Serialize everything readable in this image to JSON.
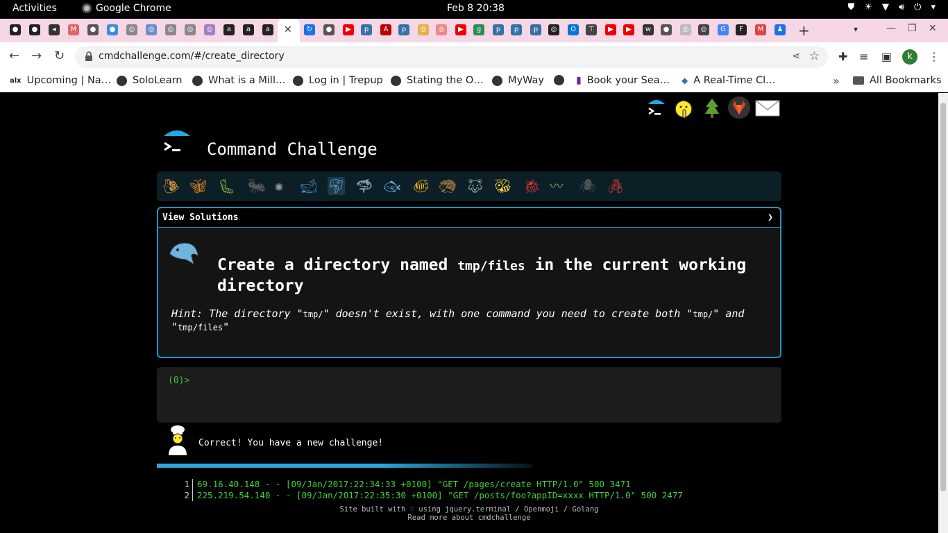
{
  "os_bar": {
    "activities": "Activities",
    "app_name": "Google Chrome",
    "clock": "Feb 8  20:38"
  },
  "browser": {
    "url": "cmdchallenge.com/#/create_directory",
    "profile_initial": "k",
    "bookmarks": [
      "Upcoming | Na…",
      "SoloLearn",
      "What is a Mill…",
      "Log in | Trepup",
      "Stating the O…",
      "MyWay",
      "Book your Sea…",
      "A Real-Time Cl…"
    ],
    "all_bookmarks": "All Bookmarks"
  },
  "site": {
    "title": "Command Challenge",
    "view_solutions": "View Solutions",
    "challenge": {
      "pre": "Create a directory named ",
      "code": "tmp/files",
      "post": " in the current working directory"
    },
    "hint": {
      "p1": "Hint: The directory \"",
      "c1": "tmp/",
      "p2": "\" doesn't exist, with one command you need to create both \"",
      "c2": "tmp/",
      "p3": "\" and \"",
      "c3": "tmp/files",
      "p4": "\""
    },
    "prompt": "(0)>",
    "message": "Correct! You have a new challenge!",
    "progress_fraction": 0.6,
    "logs": [
      {
        "num": "1",
        "text": "69.16.40.148 - - [09/Jan/2017:22:34:33 +0100] \"GET /pages/create HTTP/1.0\" 500 3471"
      },
      {
        "num": "2",
        "text": "225.219.54.140 - - [09/Jan/2017:22:35:30 +0100] \"GET /posts/foo?appID=xxxx HTTP/1.0\" 500 2477"
      }
    ],
    "footer_line1": "Site built with ♡ using jquery.terminal / Openmoji / Golang",
    "footer_line2": "Read more about cmdchallenge",
    "animals": [
      "snail",
      "butterfly",
      "caterpillar",
      "ant",
      "spider-web",
      "whale",
      "dolphin",
      "shark",
      "fish",
      "tropical-fish",
      "hedgehog",
      "wolf",
      "bee",
      "ladybug",
      "worm",
      "spider",
      "scorpion"
    ]
  }
}
